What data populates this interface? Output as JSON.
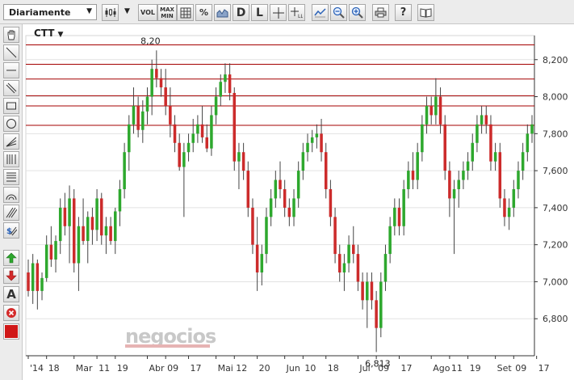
{
  "toolbar": {
    "period_label": "Diariamente",
    "vol_label": "VOL",
    "maxmin_label_1": "MAX",
    "maxmin_label_2": "MIN",
    "percent_label": "%",
    "d_label": "D",
    "l_label": "L",
    "help_label": "?"
  },
  "left_toolbar": {
    "text_tool_label": "A"
  },
  "chart": {
    "ticker": "CTT",
    "watermark": "negocios",
    "colors": {
      "up": "#2ea82e",
      "down": "#cc2b2b",
      "hline": "#a40000",
      "grid": "#e2e2e2",
      "axis": "#333333"
    }
  },
  "chart_data": {
    "type": "candlestick",
    "ylim": [
      6.6,
      8.33
    ],
    "y_ticks": [
      "8,200",
      "8,000",
      "7,800",
      "7,600",
      "7,400",
      "7,200",
      "7,000",
      "6,800"
    ],
    "y_tick_values": [
      8.2,
      8.0,
      7.8,
      7.6,
      7.4,
      7.2,
      7.0,
      6.8
    ],
    "x_labels": [
      "'14",
      "18",
      "Mar",
      "11",
      "19",
      "Abr",
      "09",
      "17",
      "Mai",
      "12",
      "20",
      "Jun",
      "10",
      "18",
      "Jul",
      "09",
      "17",
      "Ago",
      "11",
      "19",
      "Set",
      "09",
      "17"
    ],
    "x_label_index": [
      0,
      4,
      10,
      15,
      19,
      26,
      30,
      35,
      41,
      45,
      50,
      56,
      60,
      65,
      72,
      76,
      81,
      88,
      92,
      96,
      102,
      106,
      111
    ],
    "hlines": [
      8.28,
      8.175,
      8.095,
      8.005,
      7.95,
      7.845
    ],
    "annotations": [
      {
        "text": "8,20",
        "index": 27,
        "value": 8.25,
        "position": "above"
      },
      {
        "text": "6,813",
        "index": 76,
        "value": 6.62,
        "position": "below"
      }
    ],
    "candles": [
      [
        7.05,
        7.12,
        6.92,
        6.95
      ],
      [
        6.95,
        7.15,
        6.88,
        7.1
      ],
      [
        7.1,
        7.12,
        6.85,
        6.95
      ],
      [
        6.95,
        7.05,
        6.9,
        7.02
      ],
      [
        7.02,
        7.25,
        7.0,
        7.2
      ],
      [
        7.2,
        7.3,
        7.08,
        7.12
      ],
      [
        7.12,
        7.25,
        7.05,
        7.22
      ],
      [
        7.22,
        7.45,
        7.15,
        7.4
      ],
      [
        7.4,
        7.48,
        7.25,
        7.3
      ],
      [
        7.3,
        7.52,
        7.1,
        7.45
      ],
      [
        7.45,
        7.5,
        7.05,
        7.1
      ],
      [
        7.1,
        7.35,
        6.95,
        7.3
      ],
      [
        7.3,
        7.45,
        7.2,
        7.22
      ],
      [
        7.22,
        7.38,
        7.1,
        7.35
      ],
      [
        7.35,
        7.4,
        7.2,
        7.28
      ],
      [
        7.28,
        7.5,
        7.22,
        7.45
      ],
      [
        7.45,
        7.48,
        7.2,
        7.25
      ],
      [
        7.25,
        7.35,
        7.15,
        7.3
      ],
      [
        7.3,
        7.35,
        7.2,
        7.22
      ],
      [
        7.22,
        7.4,
        7.15,
        7.38
      ],
      [
        7.38,
        7.55,
        7.3,
        7.5
      ],
      [
        7.5,
        7.75,
        7.45,
        7.7
      ],
      [
        7.7,
        7.9,
        7.6,
        7.85
      ],
      [
        7.85,
        8.05,
        7.8,
        7.95
      ],
      [
        7.95,
        8.0,
        7.78,
        7.82
      ],
      [
        7.82,
        7.98,
        7.75,
        7.92
      ],
      [
        7.92,
        8.05,
        7.85,
        8.0
      ],
      [
        8.0,
        8.2,
        7.9,
        8.15
      ],
      [
        8.15,
        8.25,
        8.05,
        8.1
      ],
      [
        8.1,
        8.15,
        8.0,
        8.05
      ],
      [
        8.05,
        8.15,
        7.9,
        7.95
      ],
      [
        7.95,
        8.05,
        7.78,
        7.85
      ],
      [
        7.85,
        7.9,
        7.7,
        7.75
      ],
      [
        7.75,
        7.8,
        7.6,
        7.62
      ],
      [
        7.62,
        7.75,
        7.35,
        7.7
      ],
      [
        7.7,
        7.8,
        7.65,
        7.75
      ],
      [
        7.75,
        7.88,
        7.7,
        7.8
      ],
      [
        7.8,
        7.9,
        7.75,
        7.85
      ],
      [
        7.85,
        7.95,
        7.75,
        7.78
      ],
      [
        7.78,
        7.85,
        7.7,
        7.72
      ],
      [
        7.72,
        7.95,
        7.68,
        7.9
      ],
      [
        7.9,
        8.05,
        7.85,
        8.0
      ],
      [
        8.0,
        8.12,
        7.95,
        8.08
      ],
      [
        8.08,
        8.18,
        8.02,
        8.12
      ],
      [
        8.12,
        8.18,
        7.98,
        8.02
      ],
      [
        8.02,
        8.05,
        7.6,
        7.65
      ],
      [
        7.65,
        7.75,
        7.5,
        7.7
      ],
      [
        7.7,
        7.75,
        7.55,
        7.6
      ],
      [
        7.6,
        7.65,
        7.35,
        7.4
      ],
      [
        7.4,
        7.45,
        7.15,
        7.2
      ],
      [
        7.2,
        7.35,
        6.95,
        7.05
      ],
      [
        7.05,
        7.2,
        6.98,
        7.15
      ],
      [
        7.15,
        7.4,
        7.1,
        7.35
      ],
      [
        7.35,
        7.5,
        7.3,
        7.45
      ],
      [
        7.45,
        7.6,
        7.4,
        7.55
      ],
      [
        7.55,
        7.65,
        7.45,
        7.5
      ],
      [
        7.5,
        7.55,
        7.35,
        7.4
      ],
      [
        7.4,
        7.45,
        7.3,
        7.35
      ],
      [
        7.35,
        7.5,
        7.3,
        7.45
      ],
      [
        7.45,
        7.65,
        7.4,
        7.6
      ],
      [
        7.6,
        7.75,
        7.55,
        7.7
      ],
      [
        7.7,
        7.8,
        7.65,
        7.75
      ],
      [
        7.75,
        7.82,
        7.7,
        7.78
      ],
      [
        7.78,
        7.85,
        7.72,
        7.8
      ],
      [
        7.8,
        7.88,
        7.65,
        7.7
      ],
      [
        7.7,
        7.75,
        7.45,
        7.5
      ],
      [
        7.5,
        7.55,
        7.3,
        7.35
      ],
      [
        7.35,
        7.4,
        7.1,
        7.15
      ],
      [
        7.15,
        7.2,
        7.0,
        7.05
      ],
      [
        7.05,
        7.15,
        6.95,
        7.1
      ],
      [
        7.1,
        7.25,
        7.05,
        7.2
      ],
      [
        7.2,
        7.3,
        7.1,
        7.15
      ],
      [
        7.15,
        7.2,
        6.95,
        7.0
      ],
      [
        7.0,
        7.05,
        6.85,
        6.9
      ],
      [
        6.9,
        7.05,
        6.75,
        7.0
      ],
      [
        7.0,
        7.05,
        6.85,
        6.9
      ],
      [
        6.9,
        6.95,
        6.62,
        6.75
      ],
      [
        6.75,
        7.05,
        6.7,
        7.0
      ],
      [
        7.0,
        7.2,
        6.95,
        7.15
      ],
      [
        7.15,
        7.35,
        7.1,
        7.3
      ],
      [
        7.3,
        7.45,
        7.25,
        7.4
      ],
      [
        7.4,
        7.45,
        7.25,
        7.3
      ],
      [
        7.3,
        7.55,
        7.25,
        7.5
      ],
      [
        7.5,
        7.65,
        7.45,
        7.6
      ],
      [
        7.6,
        7.7,
        7.5,
        7.55
      ],
      [
        7.55,
        7.75,
        7.5,
        7.7
      ],
      [
        7.7,
        7.9,
        7.65,
        7.85
      ],
      [
        7.85,
        8.0,
        7.8,
        7.95
      ],
      [
        7.95,
        8.0,
        7.85,
        7.9
      ],
      [
        7.9,
        8.1,
        7.85,
        8.0
      ],
      [
        8.0,
        8.05,
        7.8,
        7.85
      ],
      [
        7.85,
        7.9,
        7.55,
        7.6
      ],
      [
        7.6,
        7.65,
        7.35,
        7.45
      ],
      [
        7.45,
        7.55,
        7.15,
        7.5
      ],
      [
        7.5,
        7.6,
        7.4,
        7.55
      ],
      [
        7.55,
        7.65,
        7.5,
        7.6
      ],
      [
        7.6,
        7.7,
        7.55,
        7.65
      ],
      [
        7.65,
        7.8,
        7.6,
        7.75
      ],
      [
        7.75,
        7.9,
        7.7,
        7.85
      ],
      [
        7.85,
        7.95,
        7.8,
        7.9
      ],
      [
        7.9,
        7.95,
        7.8,
        7.85
      ],
      [
        7.85,
        7.9,
        7.6,
        7.65
      ],
      [
        7.65,
        7.75,
        7.6,
        7.7
      ],
      [
        7.7,
        7.75,
        7.4,
        7.45
      ],
      [
        7.45,
        7.5,
        7.3,
        7.35
      ],
      [
        7.35,
        7.45,
        7.28,
        7.4
      ],
      [
        7.4,
        7.55,
        7.35,
        7.5
      ],
      [
        7.5,
        7.65,
        7.45,
        7.6
      ],
      [
        7.6,
        7.75,
        7.55,
        7.7
      ],
      [
        7.7,
        7.85,
        7.65,
        7.8
      ],
      [
        7.8,
        7.9,
        7.75,
        7.85
      ]
    ]
  }
}
